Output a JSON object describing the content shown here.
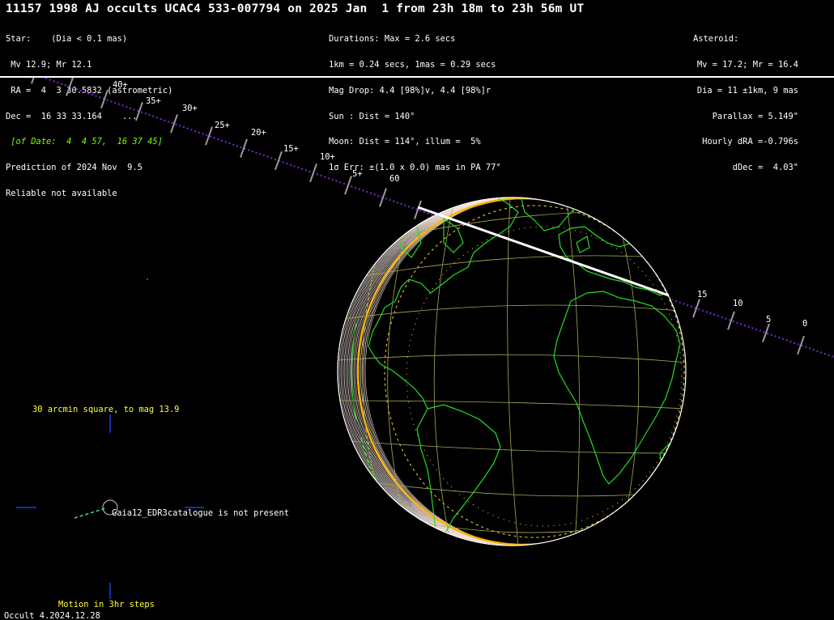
{
  "title": "11157 1998 AJ occults UCAC4 533-007794 on 2025 Jan  1 from 23h 18m to 23h 56m UT",
  "star": {
    "line1": "Star:    (Dia < 0.1 mas)",
    "line2": " Mv 12.9; Mr 12.1",
    "line3": " RA =  4  3 30.5832 (astrometric)",
    "line4": "Dec =  16 33 33.164    ...",
    "line5": " [of Date:  4  4 57,  16 37 45]",
    "line6": "Prediction of 2024 Nov  9.5",
    "line7": "Reliable not available"
  },
  "event": {
    "line1": "Durations: Max = 2.6 secs",
    "line2": "1km = 0.24 secs, 1mas = 0.29 secs",
    "line3": "Mag Drop: 4.4 [98%]v, 4.4 [98%]r",
    "line4": "Sun : Dist = 140°",
    "line5": "Moon: Dist = 114°, illum =  5%",
    "line6": "1σ Err: ±(1.0 x 0.0) mas in PA 77°"
  },
  "asteroid": {
    "line1": "Asteroid:",
    "line2": "Mv = 17.2; Mr = 16.4",
    "line3": "Dia = 11 ±1km, 9 mas",
    "line4": "Parallax = 5.149\"",
    "line5": "Hourly dRA =-0.796s",
    "line6": "dDec =  4.03\""
  },
  "track_labels": {
    "t40": "40+",
    "t35": "35+",
    "t30": "30+",
    "t25": "25+",
    "t20": "20+",
    "t15": "15+",
    "t10": "10+",
    "t5": "5+",
    "t60": "60",
    "r15": "15",
    "r10": "10",
    "r5": "5",
    "r0": "0"
  },
  "starchart": {
    "caption": "30 arcmin square, to mag 13.9",
    "note": "Gaia12_EDR3catalogue is not present",
    "motion": "Motion in 3hr steps"
  },
  "footer": {
    "version": "Occult 4.2024.12.28"
  },
  "colors": {
    "track": "#7a2bd6",
    "coast": "#22dd22",
    "grid": "#b8b860",
    "limit": "#ffb000"
  }
}
